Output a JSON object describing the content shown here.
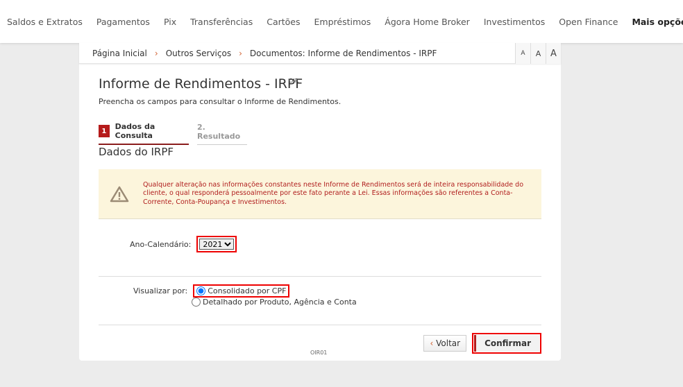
{
  "nav": [
    "Saldos e Extratos",
    "Pagamentos",
    "Pix",
    "Transferências",
    "Cartões",
    "Empréstimos",
    "Ágora Home Broker",
    "Investimentos",
    "Open Finance"
  ],
  "nav_more": "Mais opções",
  "breadcrumb": [
    "Página Inicial",
    "Outros Serviços",
    "Documentos: Informe de Rendimentos - IRPF"
  ],
  "font_sizes": [
    "A",
    "A",
    "A"
  ],
  "title": "Informe de Rendimentos - IRPF",
  "title_code": "OIR",
  "subtitle": "Preencha os campos para consultar o Informe de Rendimentos.",
  "steps": {
    "num": "1",
    "step1": "Dados da Consulta",
    "step2": "2. Resultado"
  },
  "section": "Dados do IRPF",
  "warning": "Qualquer alteração nas informações constantes neste Informe de Rendimentos será de inteira responsabilidade do cliente, o qual responderá pessoalmente por este fato perante a Lei. Essas informações são referentes a Conta-Corrente, Conta-Poupança e Investimentos.",
  "year_label": "Ano-Calendário:",
  "year_value": "2021",
  "view_label": "Visualizar por:",
  "view_options": [
    "Consolidado por CPF",
    "Detalhado por Produto, Agência e Conta"
  ],
  "back": "Voltar",
  "confirm": "Confirmar",
  "footer_code": "OIR01"
}
